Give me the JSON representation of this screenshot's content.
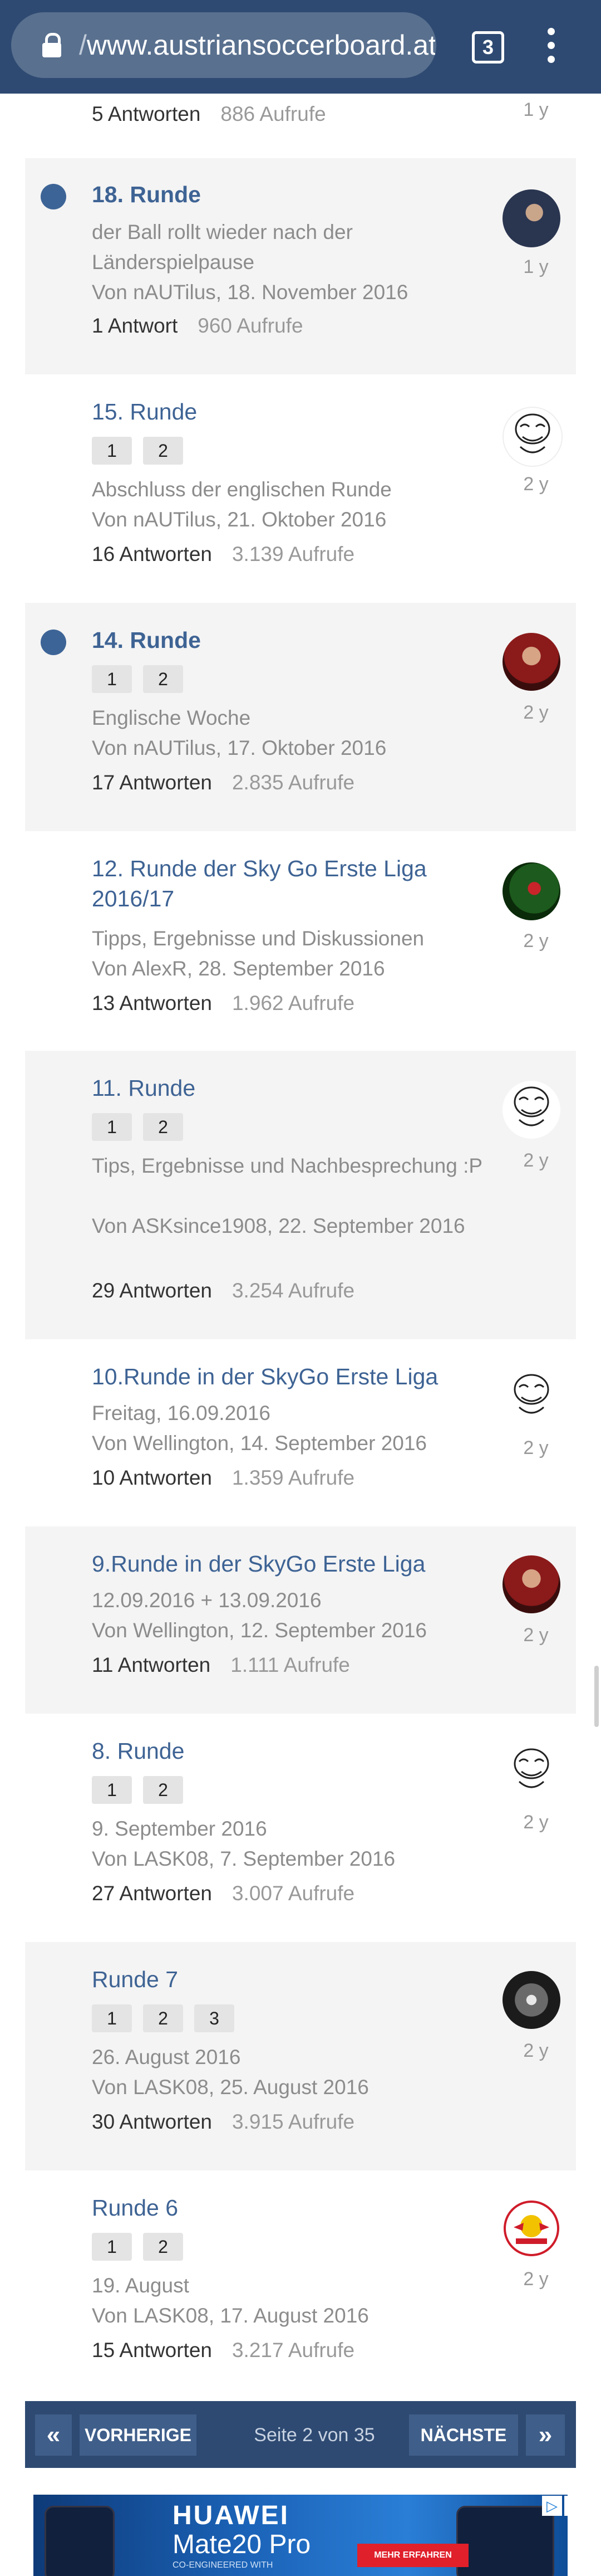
{
  "browser": {
    "url": "www.austriansoccerboard.at",
    "url_prefix": "/",
    "tab_count": "3"
  },
  "top_partial": {
    "stats_answers": "5 Antworten",
    "stats_views": "886 Aufrufe",
    "age": "1 y"
  },
  "threads": [
    {
      "title": "18. Runde",
      "subtitle": "der Ball rollt wieder nach der Länderspielpause",
      "by": "Von nAUTilus, 18. November 2016",
      "answers": "1 Antwort",
      "views": "960 Aufrufe",
      "age": "1 y",
      "unread": true,
      "pages": []
    },
    {
      "title": "15. Runde",
      "subtitle": "Abschluss der englischen Runde",
      "by": "Von nAUTilus, 21. Oktober 2016",
      "answers": "16 Antworten",
      "views": "3.139 Aufrufe",
      "age": "2 y",
      "unread": false,
      "pages": [
        "1",
        "2"
      ]
    },
    {
      "title": "14. Runde",
      "subtitle": "Englische Woche",
      "by": "Von nAUTilus, 17. Oktober 2016",
      "answers": "17 Antworten",
      "views": "2.835 Aufrufe",
      "age": "2 y",
      "unread": true,
      "pages": [
        "1",
        "2"
      ]
    },
    {
      "title": "12. Runde der Sky Go Erste Liga 2016/17",
      "subtitle": "Tipps, Ergebnisse und Diskussionen",
      "by": "Von AlexR, 28. September 2016",
      "answers": "13 Antworten",
      "views": "1.962 Aufrufe",
      "age": "2 y",
      "unread": false,
      "pages": []
    },
    {
      "title": "11. Runde",
      "subtitle": "Tips, Ergebnisse und Nachbesprechung :P",
      "by": "Von ASKsince1908, 22. September 2016",
      "answers": "29 Antworten",
      "views": "3.254 Aufrufe",
      "age": "2 y",
      "unread": false,
      "pages": [
        "1",
        "2"
      ]
    },
    {
      "title": "10.Runde in der SkyGo Erste Liga",
      "subtitle": "Freitag, 16.09.2016",
      "by": "Von Wellington, 14. September 2016",
      "answers": "10 Antworten",
      "views": "1.359 Aufrufe",
      "age": "2 y",
      "unread": false,
      "pages": []
    },
    {
      "title": "9.Runde in der SkyGo Erste Liga",
      "subtitle": "12.09.2016 + 13.09.2016",
      "by": "Von Wellington, 12. September 2016",
      "answers": "11 Antworten",
      "views": "1.111 Aufrufe",
      "age": "2 y",
      "unread": false,
      "pages": []
    },
    {
      "title": "8. Runde",
      "subtitle": "9. September 2016",
      "by": "Von LASK08, 7. September 2016",
      "answers": "27 Antworten",
      "views": "3.007 Aufrufe",
      "age": "2 y",
      "unread": false,
      "pages": [
        "1",
        "2"
      ]
    },
    {
      "title": "Runde 7",
      "subtitle": "26. August 2016",
      "by": "Von LASK08, 25. August 2016",
      "answers": "30 Antworten",
      "views": "3.915 Aufrufe",
      "age": "2 y",
      "unread": false,
      "pages": [
        "1",
        "2",
        "3"
      ]
    },
    {
      "title": "Runde 6",
      "subtitle": "19. August",
      "by": "Von LASK08, 17. August 2016",
      "answers": "15 Antworten",
      "views": "3.217 Aufrufe",
      "age": "2 y",
      "unread": false,
      "pages": [
        "1",
        "2"
      ]
    }
  ],
  "pagination": {
    "prev_label": "VORHERIGE",
    "next_label": "NÄCHSTE",
    "info": "Seite 2 von 35",
    "first_icon": "«",
    "last_icon": "»"
  },
  "ad": {
    "brand": "HUAWEI",
    "model": "Mate20 Pro",
    "sub": "CO-ENGINEERED WITH",
    "cta": "MEHR ERFAHREN",
    "colors": {
      "accent": "#e0202a",
      "bg": "#1b63b8"
    }
  },
  "colors": {
    "header": "#2e4a72",
    "link": "#3e6394",
    "unread": "#3d6496"
  }
}
